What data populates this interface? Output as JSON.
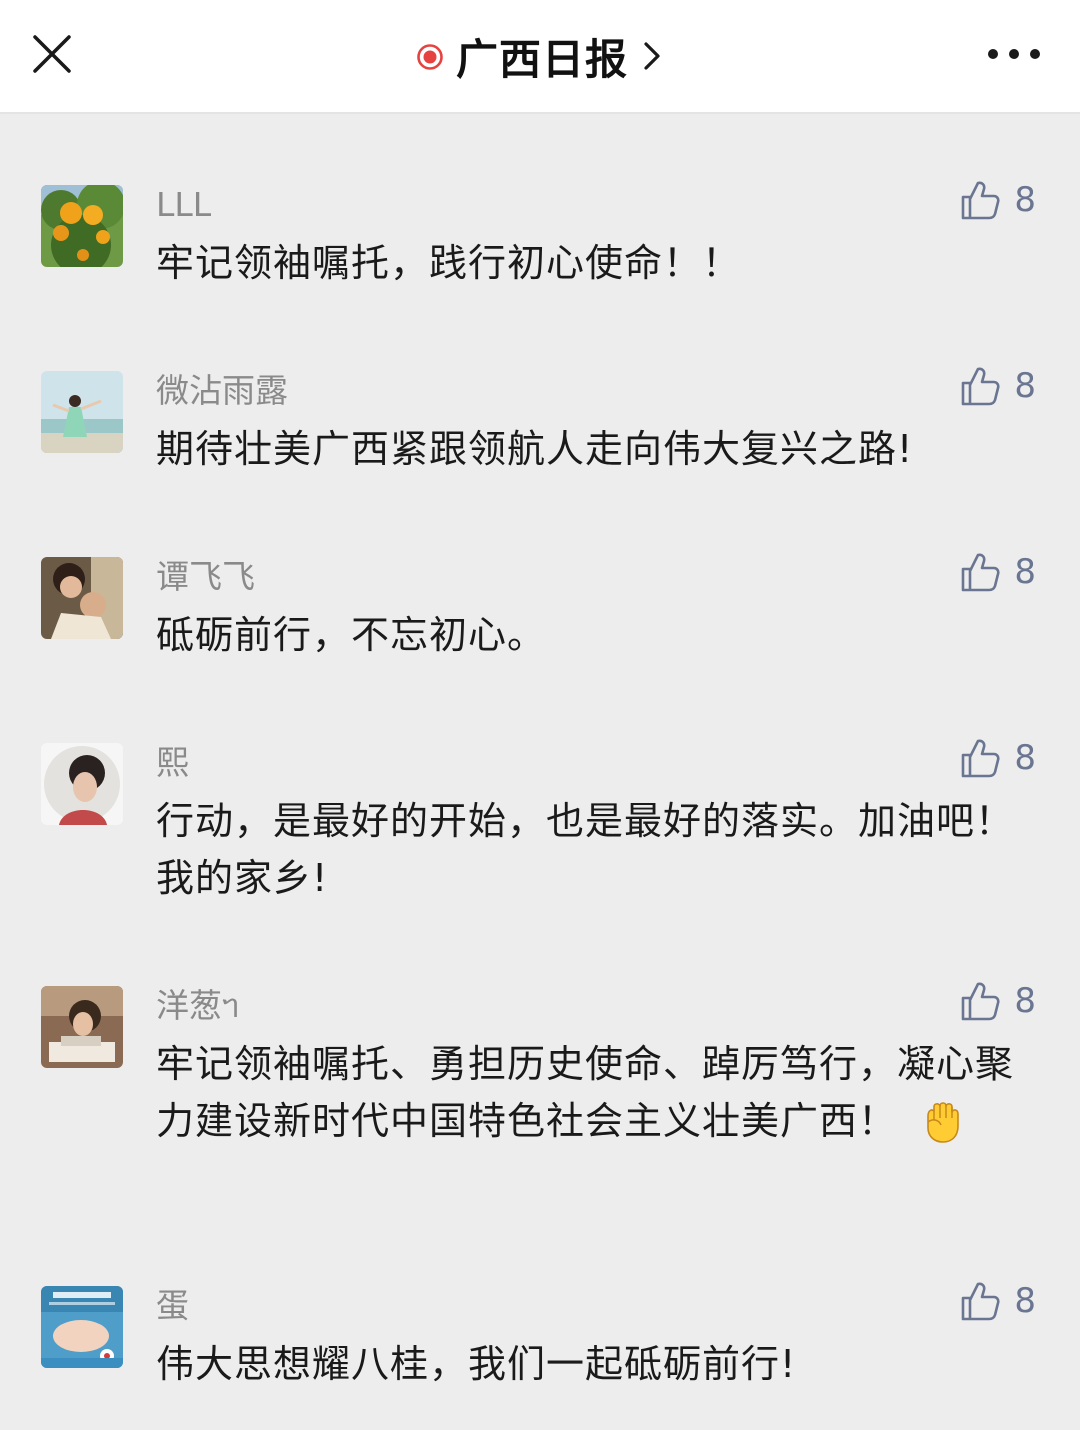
{
  "header": {
    "title": "广西日报",
    "icons": {
      "close": "close-icon",
      "live_dot": "record-dot-icon",
      "chevron": "chevron-right-icon",
      "more": "more-dots-icon"
    },
    "accent_color": "#e64340"
  },
  "comments": [
    {
      "name": "LLL",
      "likes": "8",
      "text": "牢记领袖嘱托，践行初心使命！！",
      "avatar": "orange-tree"
    },
    {
      "name": "微沾雨露",
      "likes": "8",
      "text": "期待壮美广西紧跟领航人走向伟大复兴之路!",
      "avatar": "woman-beach"
    },
    {
      "name": "谭飞飞",
      "likes": "8",
      "text": "砥砺前行，不忘初心。",
      "avatar": "couple-photo"
    },
    {
      "name": "熙",
      "likes": "8",
      "text": "行动，是最好的开始，也是最好的落实。加油吧！我的家乡!",
      "avatar": "woman-portrait"
    },
    {
      "name": "洋葱ᥐ",
      "likes": "8",
      "text": "牢记领袖嘱托、勇担历史使命、踔厉笃行，凝心聚力建设新时代中国特色社会主义壮美广西！",
      "emoji": "raised-fist-emoji",
      "avatar": "child-reading"
    },
    {
      "name": "蛋",
      "likes": "8",
      "text": "伟大思想耀八桂，我们一起砥砺前行!",
      "avatar": "together-poster"
    }
  ],
  "colors": {
    "background": "#ededed",
    "name": "#8a8a8a",
    "like": "#6a7591",
    "text": "#1a1a1a"
  }
}
